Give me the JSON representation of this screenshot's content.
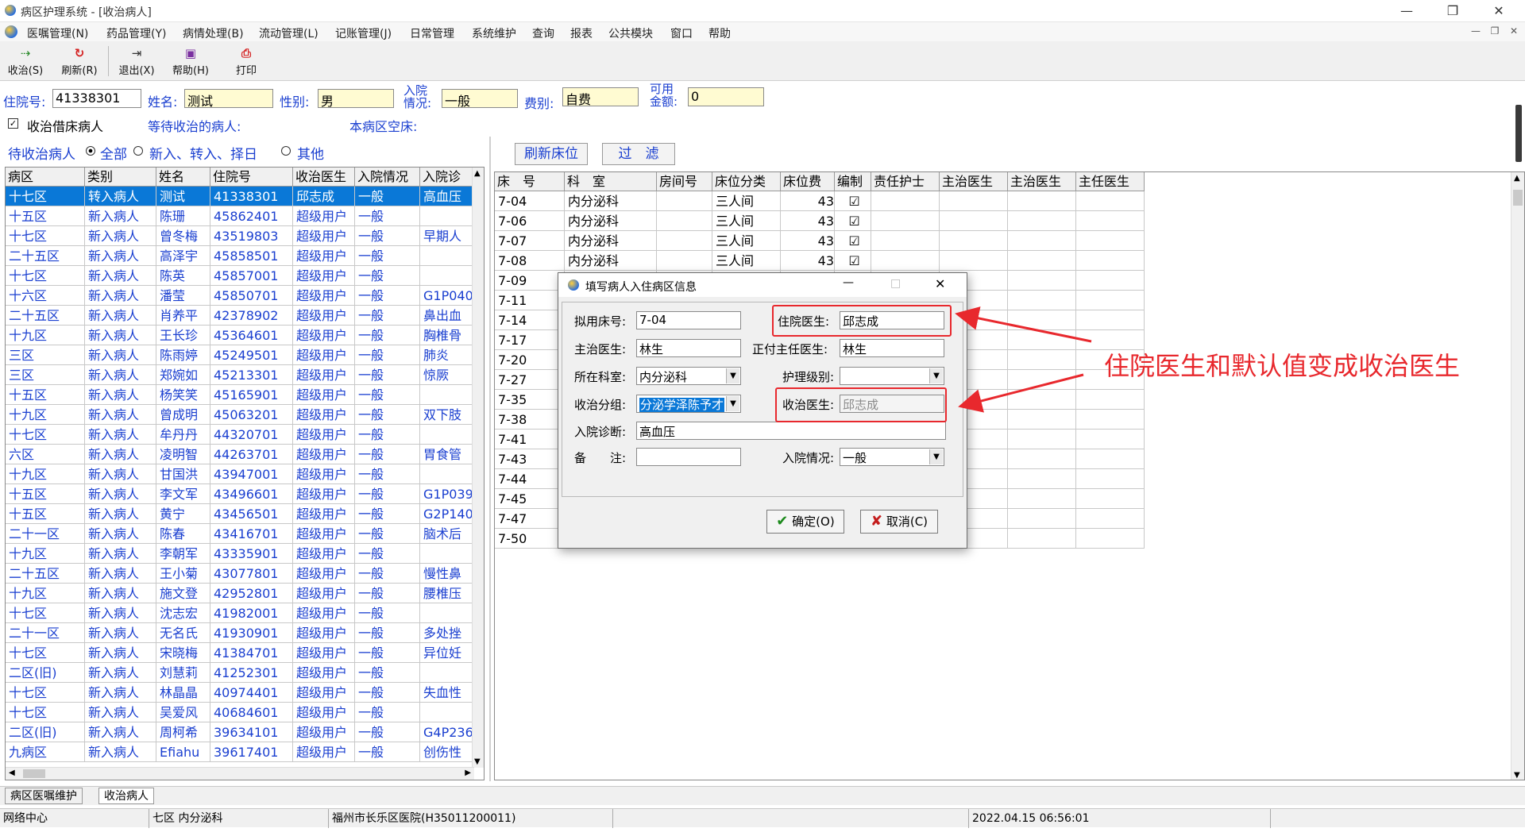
{
  "window": {
    "title": "病区护理系统 - [收治病人]",
    "controls": {
      "minimize": "—",
      "restore": "❐",
      "close": "✕"
    }
  },
  "menu": [
    "医嘱管理(N)",
    "药品管理(Y)",
    "病情处理(B)",
    "流动管理(L)",
    "记账管理(J)",
    "日常管理",
    "系统维护",
    "查询",
    "报表",
    "公共模块",
    "窗口",
    "帮助"
  ],
  "toolbar": [
    {
      "label": "收治(S)",
      "icon": "admit-icon"
    },
    {
      "label": "刷新(R)",
      "icon": "refresh-icon"
    },
    {
      "label": "退出(X)",
      "icon": "exit-icon"
    },
    {
      "label": "帮助(H)",
      "icon": "help-book-icon"
    },
    {
      "label": "打印",
      "icon": "print-icon"
    }
  ],
  "patient": {
    "id_label": "住院号:",
    "id": "41338301",
    "name_label": "姓名:",
    "name": "测试",
    "sex_label": "性别:",
    "sex": "男",
    "admit_label_1": "入院",
    "admit_label_2": "情况:",
    "admit_status": "一般",
    "fee_label": "费别:",
    "fee": "自费",
    "balance_label_1": "可用",
    "balance_label_2": "金额:",
    "balance": "0"
  },
  "options": {
    "borrow_bed_label": "收治借床病人",
    "waiting_label": "等待收治的病人:",
    "empty_bed_label": "本病区空床:",
    "filter_title": "待收治病人",
    "radios": [
      "全部",
      "新入、转入、择日",
      "其他"
    ]
  },
  "buttons": {
    "refresh_beds": "刷新床位",
    "filter": "过　滤"
  },
  "left_grid": {
    "columns": [
      "病区",
      "类别",
      "姓名",
      "住院号",
      "收治医生",
      "入院情况",
      "入院诊"
    ],
    "rows": [
      [
        "十七区",
        "转入病人",
        "测试",
        "41338301",
        "邱志成",
        "一般",
        "高血压"
      ],
      [
        "十五区",
        "新入病人",
        "陈珊",
        "45862401",
        "超级用户",
        "一般",
        ""
      ],
      [
        "十七区",
        "新入病人",
        "曾冬梅",
        "43519803",
        "超级用户",
        "一般",
        "早期人"
      ],
      [
        "二十五区",
        "新入病人",
        "高泽宇",
        "45858501",
        "超级用户",
        "一般",
        ""
      ],
      [
        "十七区",
        "新入病人",
        "陈英",
        "45857001",
        "超级用户",
        "一般",
        ""
      ],
      [
        "十六区",
        "新入病人",
        "潘莹",
        "45850701",
        "超级用户",
        "一般",
        "G1P040"
      ],
      [
        "二十五区",
        "新入病人",
        "肖养平",
        "42378902",
        "超级用户",
        "一般",
        "鼻出血"
      ],
      [
        "十九区",
        "新入病人",
        "王长珍",
        "45364601",
        "超级用户",
        "一般",
        "胸椎骨"
      ],
      [
        "三区",
        "新入病人",
        "陈雨婷",
        "45249501",
        "超级用户",
        "一般",
        "肺炎"
      ],
      [
        "三区",
        "新入病人",
        "郑婉如",
        "45213301",
        "超级用户",
        "一般",
        "惊厥"
      ],
      [
        "十五区",
        "新入病人",
        "杨笑笑",
        "45165901",
        "超级用户",
        "一般",
        ""
      ],
      [
        "十九区",
        "新入病人",
        "曾成明",
        "45063201",
        "超级用户",
        "一般",
        "双下肢"
      ],
      [
        "十七区",
        "新入病人",
        "牟丹丹",
        "44320701",
        "超级用户",
        "一般",
        ""
      ],
      [
        "六区",
        "新入病人",
        "凌明智",
        "44263701",
        "超级用户",
        "一般",
        "胃食管"
      ],
      [
        "十九区",
        "新入病人",
        "甘国洪",
        "43947001",
        "超级用户",
        "一般",
        ""
      ],
      [
        "十五区",
        "新入病人",
        "李文军",
        "43496601",
        "超级用户",
        "一般",
        "G1P039"
      ],
      [
        "十五区",
        "新入病人",
        "黄宁",
        "43456501",
        "超级用户",
        "一般",
        "G2P140"
      ],
      [
        "二十一区",
        "新入病人",
        "陈春",
        "43416701",
        "超级用户",
        "一般",
        "脑术后"
      ],
      [
        "十九区",
        "新入病人",
        "李朝军",
        "43335901",
        "超级用户",
        "一般",
        ""
      ],
      [
        "二十五区",
        "新入病人",
        "王小菊",
        "43077801",
        "超级用户",
        "一般",
        "慢性鼻"
      ],
      [
        "十九区",
        "新入病人",
        "施文登",
        "42952801",
        "超级用户",
        "一般",
        "腰椎压"
      ],
      [
        "十七区",
        "新入病人",
        "沈志宏",
        "41982001",
        "超级用户",
        "一般",
        ""
      ],
      [
        "二十一区",
        "新入病人",
        "无名氏",
        "41930901",
        "超级用户",
        "一般",
        "多处挫"
      ],
      [
        "十七区",
        "新入病人",
        "宋晓梅",
        "41384701",
        "超级用户",
        "一般",
        "异位妊"
      ],
      [
        "二区(旧)",
        "新入病人",
        "刘慧莉",
        "41252301",
        "超级用户",
        "一般",
        ""
      ],
      [
        "十七区",
        "新入病人",
        "林晶晶",
        "40974401",
        "超级用户",
        "一般",
        "失血性"
      ],
      [
        "十七区",
        "新入病人",
        "吴爱风",
        "40684601",
        "超级用户",
        "一般",
        ""
      ],
      [
        "二区(旧)",
        "新入病人",
        "周柯希",
        "39634101",
        "超级用户",
        "一般",
        "G4P236"
      ],
      [
        "九病区",
        "新入病人",
        "Efiahu",
        "39617401",
        "超级用户",
        "一般",
        "创伤性"
      ]
    ]
  },
  "right_grid": {
    "columns": [
      "床　号",
      "科　室",
      "房间号",
      "床位分类",
      "床位费",
      "编制",
      "责任护士",
      "主治医生",
      "主治医生",
      "主任医生"
    ],
    "rows": [
      [
        "7-04",
        "内分泌科",
        "",
        "三人间",
        "43",
        "☑"
      ],
      [
        "7-06",
        "内分泌科",
        "",
        "三人间",
        "43",
        "☑"
      ],
      [
        "7-07",
        "内分泌科",
        "",
        "三人间",
        "43",
        "☑"
      ],
      [
        "7-08",
        "内分泌科",
        "",
        "三人间",
        "43",
        "☑"
      ],
      [
        "7-09",
        "",
        "",
        "",
        "",
        ""
      ],
      [
        "7-11",
        "",
        "",
        "",
        "",
        ""
      ],
      [
        "7-14",
        "",
        "",
        "",
        "",
        ""
      ],
      [
        "7-17",
        "",
        "",
        "",
        "",
        ""
      ],
      [
        "7-20",
        "",
        "",
        "",
        "",
        ""
      ],
      [
        "7-27",
        "",
        "",
        "",
        "",
        ""
      ],
      [
        "7-35",
        "",
        "",
        "",
        "",
        ""
      ],
      [
        "7-38",
        "",
        "",
        "",
        "",
        ""
      ],
      [
        "7-41",
        "",
        "",
        "",
        "",
        ""
      ],
      [
        "7-43",
        "",
        "",
        "",
        "",
        ""
      ],
      [
        "7-44",
        "",
        "",
        "",
        "",
        ""
      ],
      [
        "7-45",
        "",
        "",
        "",
        "",
        ""
      ],
      [
        "7-47",
        "",
        "",
        "",
        "",
        ""
      ],
      [
        "7-50",
        "",
        "",
        "",
        "",
        ""
      ]
    ]
  },
  "dialog": {
    "title": "填写病人入住病区信息",
    "bed_label": "拟用床号:",
    "bed": "7-04",
    "inpatient_doctor_label": "住院医生:",
    "inpatient_doctor": "邱志成",
    "attending_label": "主治医生:",
    "attending": "林生",
    "chief_label": "正付主任医生:",
    "chief": "林生",
    "dept_label": "所在科室:",
    "dept": "内分泌科",
    "nursing_label": "护理级别:",
    "nursing": "",
    "group_label": "收治分组:",
    "group": "分泌学泽陈予才",
    "admit_doctor_label": "收治医生:",
    "admit_doctor": "邱志成",
    "diagnosis_label": "入院诊断:",
    "diagnosis": "高血压",
    "note_label": "备　　注:",
    "note": "",
    "admit_status_label": "入院情况:",
    "admit_status": "一般",
    "ok": "确定(O)",
    "cancel": "取消(C)"
  },
  "annotation": {
    "text": "住院医生和默认值变成收治医生",
    "color": "#e8282d"
  },
  "tabs": [
    "病区医嘱维护",
    "收治病人"
  ],
  "status": {
    "network": "网络中心",
    "ward": "七区 内分泌科",
    "hospital": "福州市长乐区医院(H35011200011)",
    "datetime": "2022.04.15 06:56:01"
  }
}
